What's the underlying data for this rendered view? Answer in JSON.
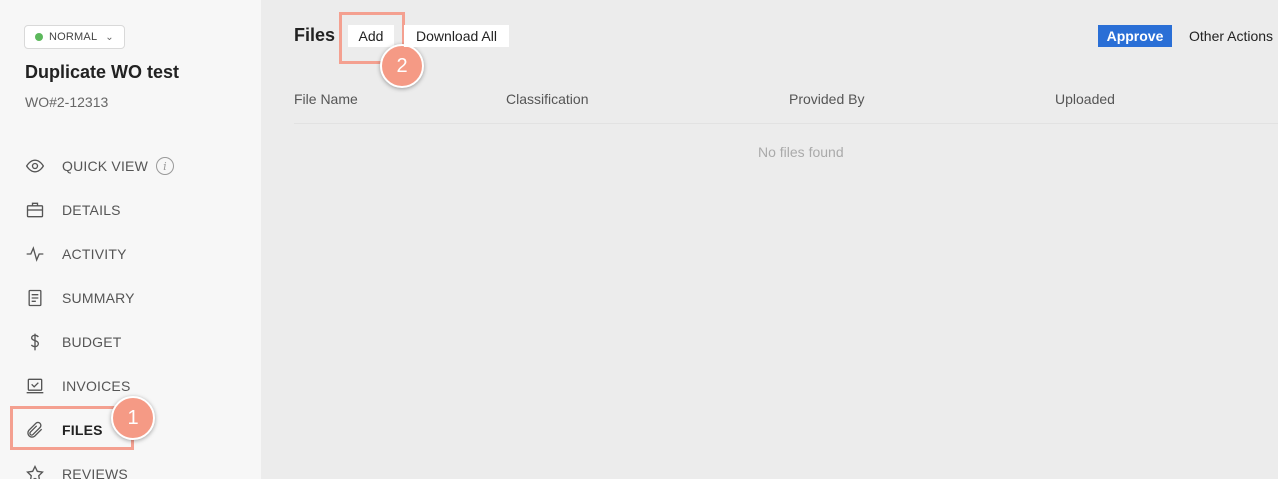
{
  "sidebar": {
    "status": "NORMAL",
    "title": "Duplicate WO test",
    "wo_number": "WO#2-12313",
    "items": [
      {
        "label": "QUICK VIEW",
        "icon": "eye-icon"
      },
      {
        "label": "DETAILS",
        "icon": "briefcase-icon"
      },
      {
        "label": "ACTIVITY",
        "icon": "pulse-icon"
      },
      {
        "label": "SUMMARY",
        "icon": "document-icon"
      },
      {
        "label": "BUDGET",
        "icon": "dollar-icon"
      },
      {
        "label": "INVOICES",
        "icon": "invoice-check-icon"
      },
      {
        "label": "FILES",
        "icon": "paperclip-icon"
      },
      {
        "label": "REVIEWS",
        "icon": "star-icon"
      }
    ],
    "active_item": "FILES"
  },
  "main": {
    "title": "Files",
    "add_label": "Add",
    "download_all_label": "Download All",
    "approve_label": "Approve",
    "other_actions_label": "Other Actions",
    "columns": [
      "File Name",
      "Classification",
      "Provided By",
      "Uploaded"
    ],
    "empty_message": "No files found"
  },
  "annotations": {
    "badge_1": "1",
    "badge_2": "2"
  },
  "colors": {
    "accent": "#2a6fd6",
    "status_green": "#5cb85c",
    "highlight": "#f4a090",
    "badge": "#f59a85"
  }
}
